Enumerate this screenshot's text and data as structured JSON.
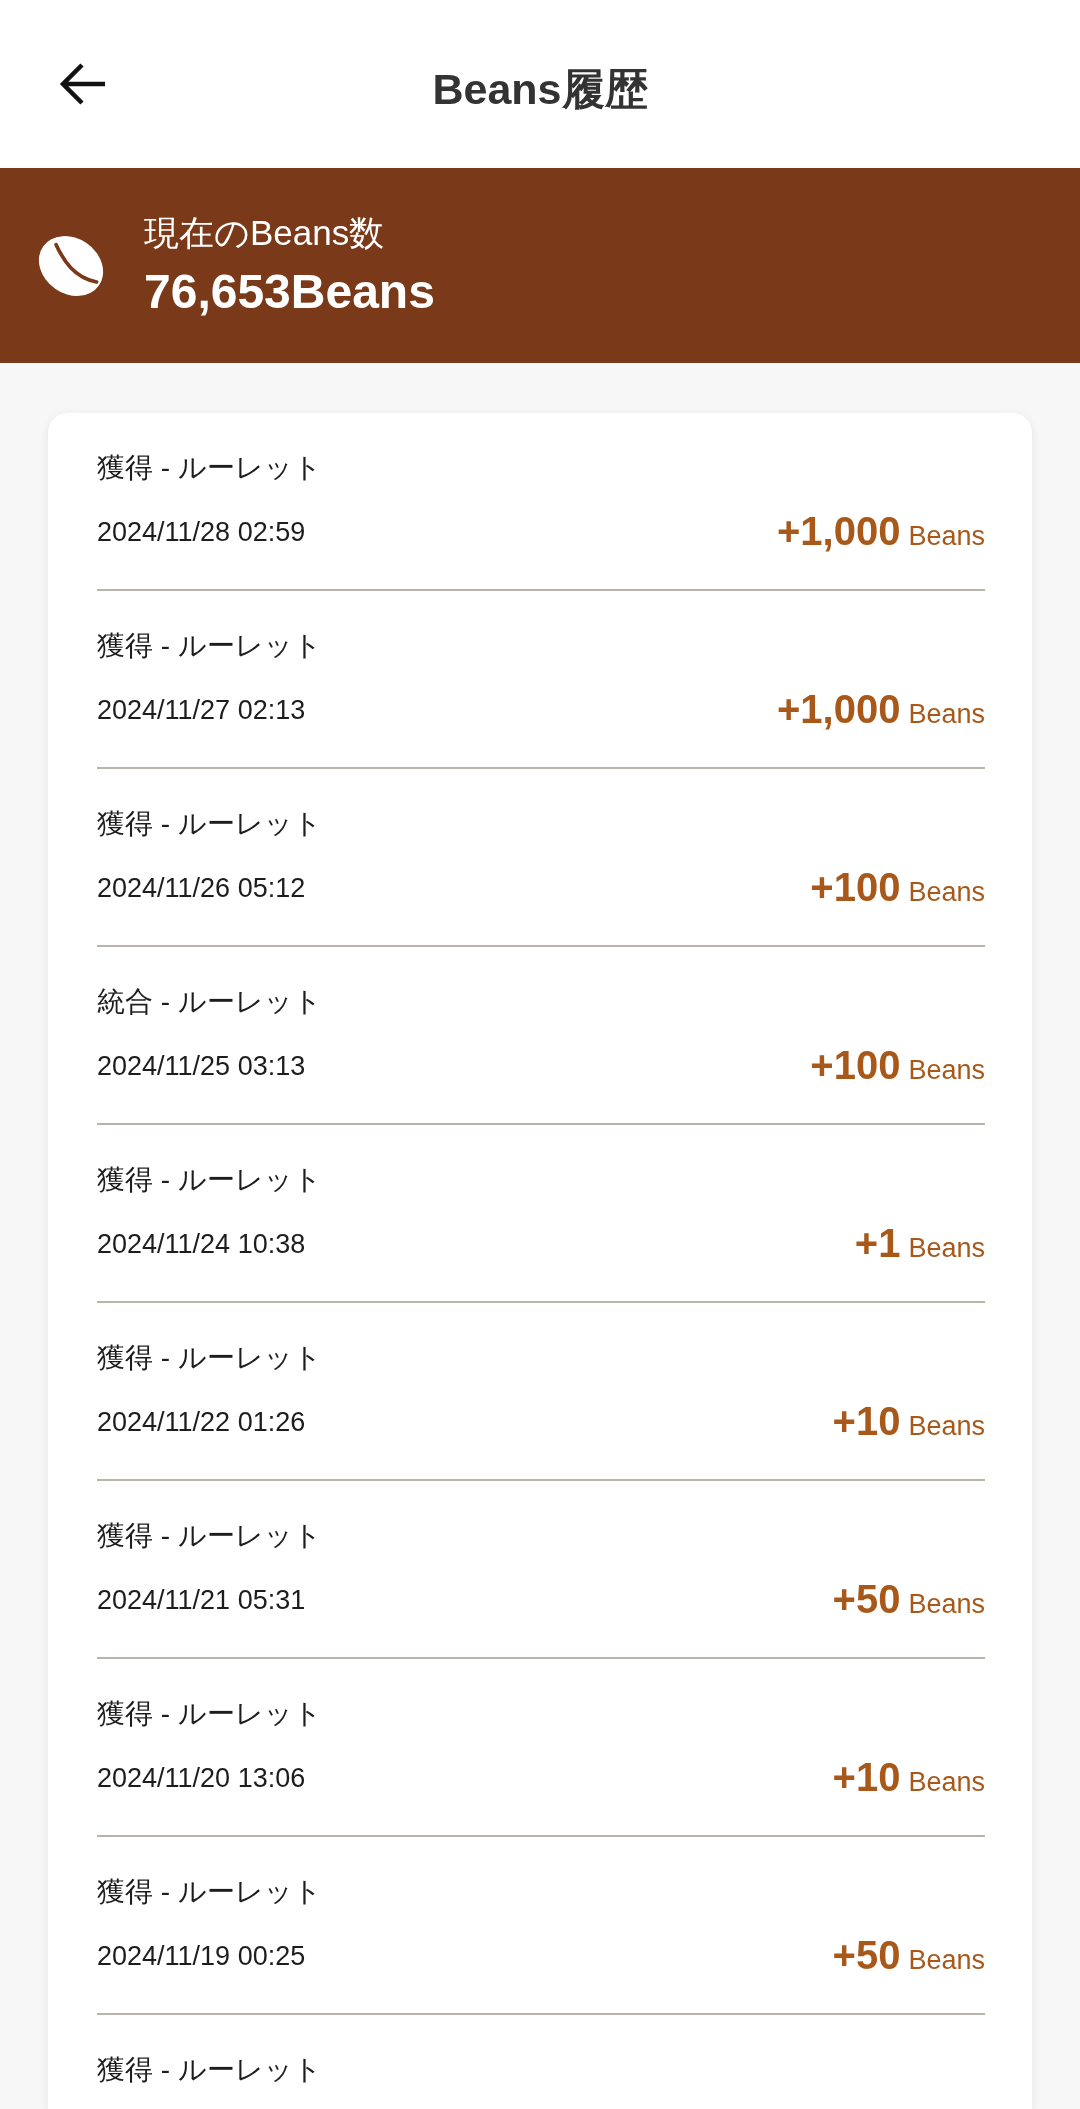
{
  "header": {
    "title": "Beans履歴"
  },
  "balance": {
    "label": "現在のBeans数",
    "value": "76,653Beans"
  },
  "history": [
    {
      "title": "獲得 - ルーレット",
      "date": "2024/11/28 02:59",
      "amount": "+1,000",
      "unit": "Beans"
    },
    {
      "title": "獲得 - ルーレット",
      "date": "2024/11/27 02:13",
      "amount": "+1,000",
      "unit": "Beans"
    },
    {
      "title": "獲得 - ルーレット",
      "date": "2024/11/26 05:12",
      "amount": "+100",
      "unit": "Beans"
    },
    {
      "title": "統合 - ルーレット",
      "date": "2024/11/25 03:13",
      "amount": "+100",
      "unit": "Beans"
    },
    {
      "title": "獲得 - ルーレット",
      "date": "2024/11/24 10:38",
      "amount": "+1",
      "unit": "Beans"
    },
    {
      "title": "獲得 - ルーレット",
      "date": "2024/11/22 01:26",
      "amount": "+10",
      "unit": "Beans"
    },
    {
      "title": "獲得 - ルーレット",
      "date": "2024/11/21 05:31",
      "amount": "+50",
      "unit": "Beans"
    },
    {
      "title": "獲得 - ルーレット",
      "date": "2024/11/20 13:06",
      "amount": "+10",
      "unit": "Beans"
    },
    {
      "title": "獲得 - ルーレット",
      "date": "2024/11/19 00:25",
      "amount": "+50",
      "unit": "Beans"
    },
    {
      "title": "獲得 - ルーレット"
    }
  ]
}
